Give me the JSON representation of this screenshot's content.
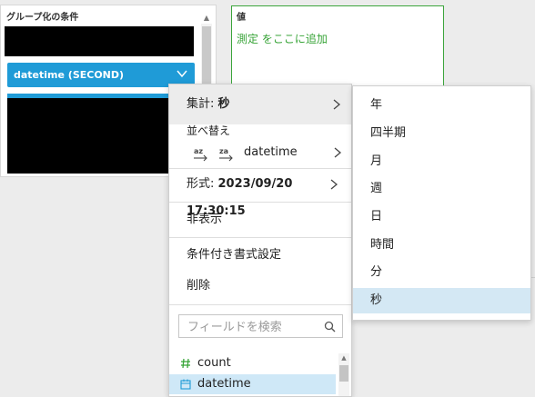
{
  "groupby": {
    "title": "グループ化の条件",
    "field_pill": "datetime (SECOND)"
  },
  "value_well": {
    "title": "値",
    "drop_hint": "測定 をここに追加"
  },
  "context_menu": {
    "aggregate": {
      "label": "集計: ",
      "value": "秒"
    },
    "sort": {
      "label": "並べ替え",
      "az_icon_text": "az",
      "za_icon_text": "za",
      "field": "datetime"
    },
    "format": {
      "label": "形式: ",
      "value": "2023/09/20 17:30:15"
    },
    "hide": "非表示",
    "conditional_format": "条件付き書式設定",
    "delete": "削除",
    "search": {
      "placeholder": "フィールドを検索",
      "value": ""
    },
    "fields": [
      {
        "icon": "hash-icon",
        "label": "count"
      },
      {
        "icon": "calendar-icon",
        "label": "datetime",
        "selected": true
      }
    ]
  },
  "aggregate_submenu": {
    "items": [
      "年",
      "四半期",
      "月",
      "週",
      "日",
      "時間",
      "分",
      "秒"
    ],
    "selected": "秒"
  },
  "colors": {
    "accent_blue": "#1f9bd7",
    "green": "#36a336",
    "selected_bg": "#d4e8f4"
  }
}
